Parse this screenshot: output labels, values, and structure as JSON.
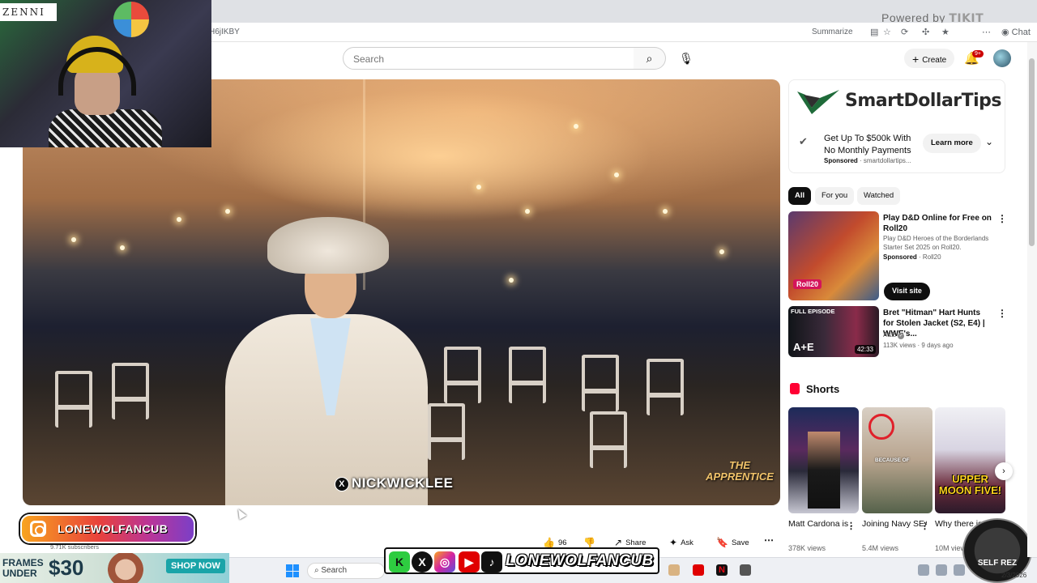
{
  "browser": {
    "url_fragment": "H6jIKBY",
    "summarize_label": "Summarize",
    "chat_label": "Chat",
    "powered_by": "Powered by",
    "powered_brand": "TIKIT"
  },
  "header": {
    "search_placeholder": "Search",
    "create_label": "Create",
    "notification_count": "9+"
  },
  "video": {
    "caption_handle": "NICKWICKLEE",
    "brand_watermark": "THE APPRENTICE"
  },
  "webcam": {
    "sponsor_logo": "ZENNI"
  },
  "ad": {
    "brand": "SmartDollarTips",
    "title": "Get Up To $500k With No Monthly Payments",
    "sponsored": "Sponsored",
    "domain": "smartdollartips...",
    "cta": "Learn more"
  },
  "chips": [
    {
      "label": "All"
    },
    {
      "label": "For you"
    },
    {
      "label": "Watched"
    }
  ],
  "recommendations": [
    {
      "title": "Play D&D Online for Free on Roll20",
      "desc": "Play D&D Heroes of the Borderlands Starter Set 2025 on Roll20.",
      "sponsored": "Sponsored",
      "channel": "Roll20",
      "cta": "Visit site",
      "thumb_text": "Roll20"
    },
    {
      "title": "Bret \"Hitman\" Hart Hunts for Stolen Jacket (S2, E4) | WWE's...",
      "channel": "A&E",
      "meta": "113K views · 9 days ago",
      "duration": "42:33",
      "thumb_text": "FULL EPISODE"
    }
  ],
  "shorts": {
    "heading": "Shorts",
    "items": [
      {
        "title": "Matt Cardona is ...",
        "views": "378K views",
        "thumb_text": ""
      },
      {
        "title": "Joining Navy SEALs ...",
        "views": "5.4M views",
        "thumb_text": "BECAUSE OF"
      },
      {
        "title": "Why there is no Upper...",
        "views": "10M views",
        "thumb_text": "UPPER MOON FIVE!"
      }
    ]
  },
  "actions": {
    "likes": "96",
    "share": "Share",
    "ask": "Ask",
    "save": "Save"
  },
  "channel": {
    "subscribers": "9.71K subscribers"
  },
  "overlays": {
    "ig_handle": "LONEWOLFANCUB",
    "social_handle": "LONEWOLFANCUB",
    "frames_line1": "FRAMES UNDER",
    "frames_price": "$30",
    "shop_now": "SHOP NOW",
    "self_rez": "SELF REZ"
  },
  "taskbar": {
    "search_placeholder": "Search",
    "date": "2/3/2026"
  },
  "colors": {
    "youtube_red": "#ff0033",
    "chip_active": "#0f0f0f",
    "ig_gradient_start": "#f8a41f",
    "ig_gradient_end": "#7b3fc7"
  }
}
